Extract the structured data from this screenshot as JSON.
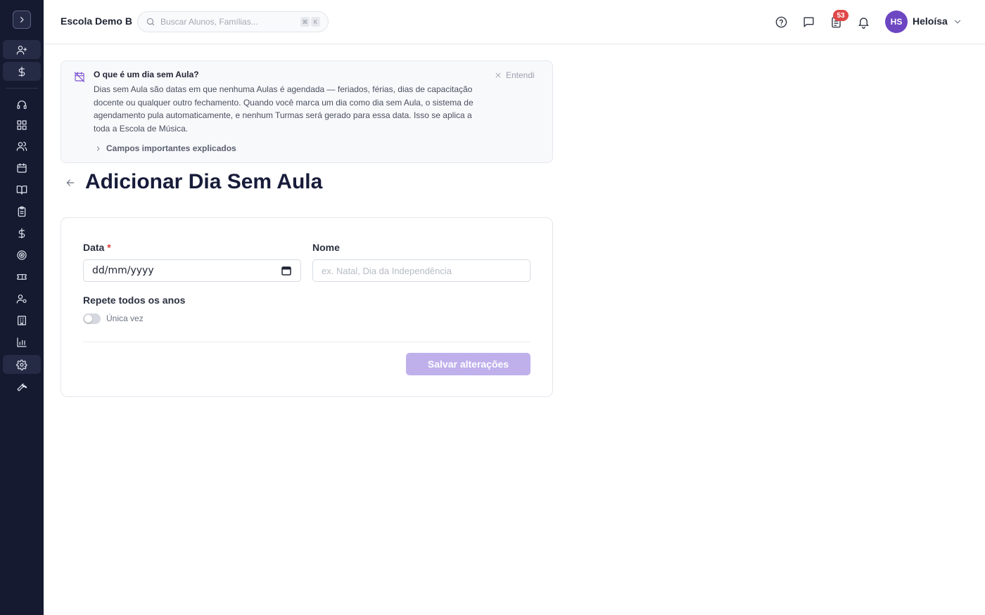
{
  "header": {
    "school_name": "Escola Demo B",
    "search_placeholder": "Buscar Alunos, Famílias...",
    "search_shortcut": [
      "⌘",
      "K"
    ],
    "tasks_badge": "53",
    "user_initials": "HS",
    "user_name": "Heloísa",
    "avatar_color": "#6d46c2"
  },
  "sidebar": {
    "items": [
      {
        "icon": "user-plus-icon"
      },
      {
        "icon": "dollar-icon"
      },
      {
        "icon": "headset-icon"
      },
      {
        "icon": "dashboard-icon"
      },
      {
        "icon": "users-icon"
      },
      {
        "icon": "calendar-icon"
      },
      {
        "icon": "book-icon"
      },
      {
        "icon": "clipboard-icon"
      },
      {
        "icon": "dollar-icon"
      },
      {
        "icon": "target-icon"
      },
      {
        "icon": "ticket-icon"
      },
      {
        "icon": "user-settings-icon"
      },
      {
        "icon": "building-icon"
      },
      {
        "icon": "bar-chart-icon"
      },
      {
        "icon": "gear-icon"
      },
      {
        "icon": "wrench-icon"
      }
    ]
  },
  "info_banner": {
    "title": "O que é um dia sem Aula?",
    "text": "Dias sem Aula são datas em que nenhuma Aulas é agendada — feriados, férias, dias de capacitação docente ou qualquer outro fechamento. Quando você marca um dia como dia sem Aula, o sistema de agendamento pula automaticamente, e nenhum Turmas será gerado para essa data. Isso se aplica a toda a Escola de Música.",
    "dismiss_label": "Entendi",
    "expand_label": "Campos importantes explicados"
  },
  "page": {
    "title": "Adicionar Dia Sem Aula"
  },
  "form": {
    "date_label": "Data",
    "date_required_mark": "*",
    "date_value": "dd/mm/yyyy",
    "name_label": "Nome",
    "name_placeholder": "ex. Natal, Dia da Independência",
    "repeat_label": "Repete todos os anos",
    "repeat_toggle_text": "Única vez",
    "repeat_enabled": false,
    "save_label": "Salvar alterações",
    "save_color": "#bfb0ec"
  }
}
